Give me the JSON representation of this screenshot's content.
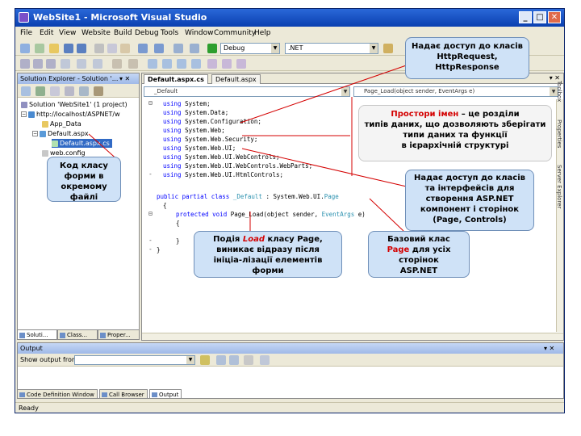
{
  "window": {
    "title": "WebSite1 - Microsoft Visual Studio",
    "minimize": "_",
    "maximize": "□",
    "close": "✕"
  },
  "menu": [
    "File",
    "Edit",
    "View",
    "Website",
    "Build",
    "Debug",
    "Tools",
    "Window",
    "Community",
    "Help"
  ],
  "toolbar": {
    "config_combo": "Debug",
    "platform_combo": ".NET"
  },
  "solution_explorer": {
    "title": "Solution Explorer - Solution '...",
    "pin": "▾ ✕",
    "tree": [
      {
        "label": "Solution 'WebSite1' (1 project)",
        "expander": ""
      },
      {
        "label": "http://localhost/ASPNET/w",
        "expander": "−"
      },
      {
        "label": "App_Data",
        "expander": ""
      },
      {
        "label": "Default.aspx",
        "expander": "−"
      },
      {
        "label": "Default.aspx.cs",
        "expander": ""
      },
      {
        "label": "web.config",
        "expander": ""
      }
    ],
    "tabs": [
      "Soluti...",
      "Class...",
      "Proper..."
    ]
  },
  "editor": {
    "tabs": [
      "Default.aspx.cs",
      "Default.aspx"
    ],
    "class_combo": "_Default",
    "member_combo": "Page_Load(object sender, EventArgs e)",
    "close": "▾ ✕",
    "code": {
      "using1_kw": "using",
      "using1_ns": " System;",
      "using2_kw": "using",
      "using2_ns": " System.Data;",
      "using3_kw": "using",
      "using3_ns": " System.Configuration;",
      "using4_kw": "using",
      "using4_ns": " System.Web;",
      "using5_kw": "using",
      "using5_ns": " System.Web.Security;",
      "using6_kw": "using",
      "using6_ns": " System.Web.UI;",
      "using7_kw": "using",
      "using7_ns": " System.Web.UI.WebControls;",
      "using8_kw": "using",
      "using8_ns": " System.Web.UI.WebControls.WebParts;",
      "using9_kw": "using",
      "using9_ns": " System.Web.UI.HtmlControls;",
      "class_kw": "public partial class",
      "class_name": " _Default",
      "class_sep": " : System.Web.UI.",
      "class_base": "Page",
      "open_brace": "{",
      "method_kw": "protected void",
      "method_sig": " Page_Load(object sender, ",
      "method_type": "EventArgs",
      "method_end": " e)",
      "method_open": "{",
      "method_close": "}",
      "close_brace": "}"
    },
    "gutter": {
      "collapse": "⊟",
      "expand": "⊟",
      "dash": "-"
    }
  },
  "right_strip": [
    "Toolbox",
    "Properties",
    "Server Explorer"
  ],
  "output": {
    "title": "Output",
    "show_from": "Show output from:",
    "close": "▾ ✕"
  },
  "output_tabs": [
    "Code Definition Window",
    "Call Browser",
    "Output"
  ],
  "status": "Ready",
  "callouts": {
    "http": {
      "line1": "Надає доступ до класів",
      "line2": "HttpRequest,",
      "line3": "HttpResponse"
    },
    "namespaces": {
      "highlight": "Простори імен",
      "rest1": " – це розділи",
      "line2": "типів даних, що дозволяють зберігати",
      "line3": "типи даних та функції",
      "line4": "в ієрархічній структурі"
    },
    "ui": {
      "line1": "Надає доступ до класів",
      "line2": "та інтерфейсів для",
      "line3": "створення ASP.NET",
      "line4": "компонент і сторінок",
      "line5": "(Page, Controls)"
    },
    "codebehind": {
      "line1": "Код класу",
      "line2": "форми в",
      "line3": "окремому",
      "line4": "файлі"
    },
    "load": {
      "pre": "Подія ",
      "highlight": "Load",
      "post": " класу Page,",
      "line2": "виникає відразу після",
      "line3": "ініціа-лізації елементів",
      "line4": "форми"
    },
    "base": {
      "line1": "Базовий клас",
      "highlight": "Page",
      "post": " для усіх",
      "line3": "сторінок",
      "line4": "ASP.NET"
    }
  }
}
